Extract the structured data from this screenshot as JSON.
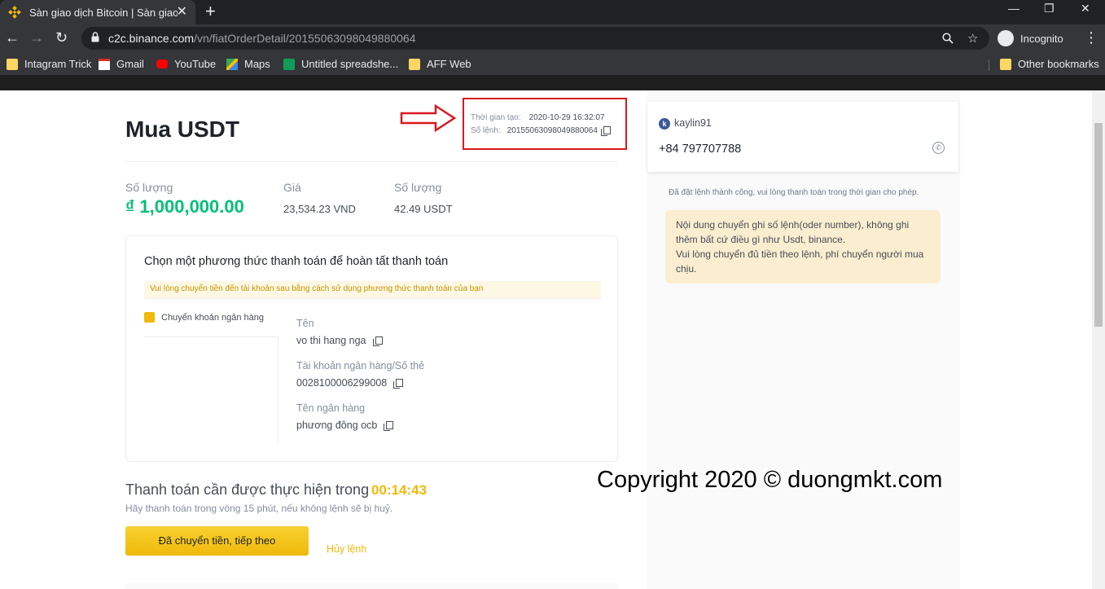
{
  "browser": {
    "tab_title": "Sàn giao dịch Bitcoin | Sàn giao d",
    "tab_close": "✕",
    "new_tab": "+",
    "url_host": "c2c.binance.com",
    "url_path": "/vn/fiatOrderDetail/20155063098049880064",
    "incognito_label": "Incognito",
    "window_controls": [
      "—",
      "❐",
      "✕"
    ],
    "nav": {
      "back": "←",
      "forward": "→",
      "reload": "↻",
      "menu": "⋮"
    }
  },
  "bookmarks": [
    {
      "label": "Intagram Trick",
      "icon": "folder-icon"
    },
    {
      "label": "Gmail",
      "icon": "gmail-icon"
    },
    {
      "label": "YouTube",
      "icon": "youtube-icon"
    },
    {
      "label": "Maps",
      "icon": "maps-icon"
    },
    {
      "label": "Untitled spreadshe...",
      "icon": "sheets-icon"
    },
    {
      "label": "AFF Web",
      "icon": "folder-icon"
    }
  ],
  "other_bookmarks": "Other bookmarks",
  "order": {
    "title": "Mua USDT",
    "created_label": "Thời gian tạo:",
    "created_value": "2020-10-29 16:32:07",
    "number_label": "Số lệnh:",
    "number_value": "20155063098049880064",
    "amount_label": "Số lượng",
    "amount_value": "₫ 1,000,000.00",
    "price_label": "Giá",
    "price_value": "23,534.23 VND",
    "qty_label": "Số lượng",
    "qty_value": "42.49 USDT"
  },
  "payment": {
    "title": "Chọn một phương thức thanh toán để hoàn tất thanh toán",
    "notice": "Vui lòng chuyển tiền đến tài khoản sau bằng cách sử dụng phương thức thanh toán của bạn",
    "method": "Chuyển khoản ngân hàng",
    "name_label": "Tên",
    "name_value": "vo thi hang nga",
    "account_label": "Tài khoản ngân hàng/Số thẻ",
    "account_value": "0028100006299008",
    "bank_label": "Tên ngân hàng",
    "bank_value": "phương đông ocb"
  },
  "timer": {
    "text": "Thanh toán cần được thực hiện trong",
    "countdown": "00:14:43",
    "hint": "Hãy thanh toán trong vòng 15 phút, nếu không lệnh sẽ bị huỷ."
  },
  "actions": {
    "paid_button": "Đã chuyển tiền, tiếp theo",
    "cancel_link": "Hủy lệnh"
  },
  "seller": {
    "avatar_letter": "k",
    "name": "kaylin91",
    "phone": "+84 797707788"
  },
  "chat": {
    "system_message": "Đã đặt lệnh thành công, vui lòng thanh toán trong thời gian cho phép.",
    "bubble_line1": "Nội dung chuyển ghi số lệnh(oder number), không ghi thêm bất cứ điều gì như Usdt, binance.",
    "bubble_line2": "Vui lòng chuyển đủ tiền theo lệnh, phí chuyển người mua chịu."
  },
  "watermark": "Copyright 2020 © duongmkt.com",
  "colors": {
    "accent": "#f0b90b",
    "positive": "#02c076",
    "annotation_red": "#d9181f"
  }
}
